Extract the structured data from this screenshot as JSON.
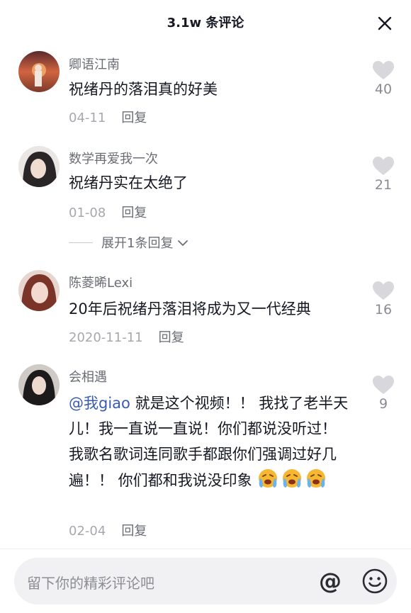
{
  "header": {
    "title": "3.1w 条评论"
  },
  "comments": [
    {
      "username": "卿语江南",
      "text": "祝绪丹的落泪真的好美",
      "date": "04-11",
      "reply_label": "回复",
      "likes": "40"
    },
    {
      "username": "数学再爱我一次",
      "text": "祝绪丹实在太绝了",
      "date": "01-08",
      "reply_label": "回复",
      "likes": "21",
      "expand_label": "展开1条回复"
    },
    {
      "username": "陈菱晞Lexi",
      "text": "20年后祝绪丹落泪将成为又一代经典",
      "date": "2020-11-11",
      "reply_label": "回复",
      "likes": "16"
    },
    {
      "username": "会相遇",
      "mention": "@我giao",
      "text": " 就是这个视频！！ 我找了老半天儿！我一直说一直说！你们都说没听过！我歌名歌词连同歌手都跟你们强调过好几遍！！ 你们都和我说没印象",
      "emojis": [
        "crying-face-emoji",
        "crying-face-emoji",
        "crying-face-emoji"
      ],
      "date": "02-04",
      "reply_label": "回复",
      "likes": "9"
    }
  ],
  "input": {
    "placeholder": "留下你的精彩评论吧",
    "at_label": "@"
  },
  "colors": {
    "mention": "#3a5bb0",
    "like_icon": "#d8d8dc",
    "input_bg": "#f1f1f3"
  }
}
